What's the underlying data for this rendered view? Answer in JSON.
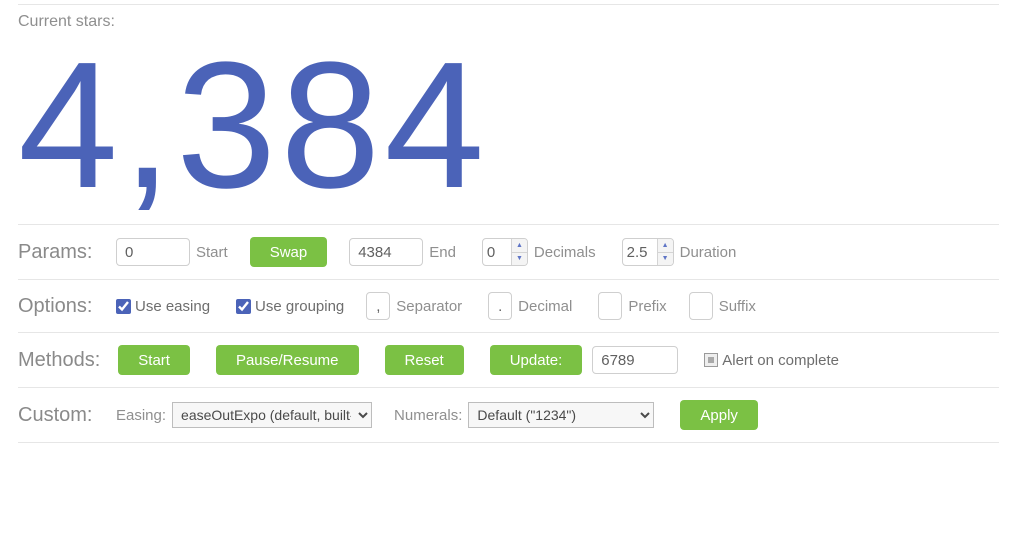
{
  "current_stars_label": "Current stars:",
  "counter_value": "4,384",
  "sections": {
    "params": {
      "label": "Params:",
      "start_value": "0",
      "start_label": "Start",
      "swap_label": "Swap",
      "end_value": "4384",
      "end_label": "End",
      "decimals_value": "0",
      "decimals_label": "Decimals",
      "duration_value": "2.5",
      "duration_label": "Duration"
    },
    "options": {
      "label": "Options:",
      "use_easing_label": "Use easing",
      "use_easing_checked": true,
      "use_grouping_label": "Use grouping",
      "use_grouping_checked": true,
      "separator_value": ",",
      "separator_label": "Separator",
      "decimal_value": ".",
      "decimal_label": "Decimal",
      "prefix_value": "",
      "prefix_label": "Prefix",
      "suffix_value": "",
      "suffix_label": "Suffix"
    },
    "methods": {
      "label": "Methods:",
      "start_label": "Start",
      "pause_label": "Pause/Resume",
      "reset_label": "Reset",
      "update_label": "Update:",
      "update_value": "6789",
      "alert_label": "Alert on complete"
    },
    "custom": {
      "label": "Custom:",
      "easing_label": "Easing:",
      "easing_options": [
        "easeOutExpo (default, built-in)"
      ],
      "easing_selected": "easeOutExpo (default, built-in)",
      "numerals_label": "Numerals:",
      "numerals_options": [
        "Default (\"1234\")"
      ],
      "numerals_selected": "Default (\"1234\")",
      "apply_label": "Apply"
    }
  }
}
